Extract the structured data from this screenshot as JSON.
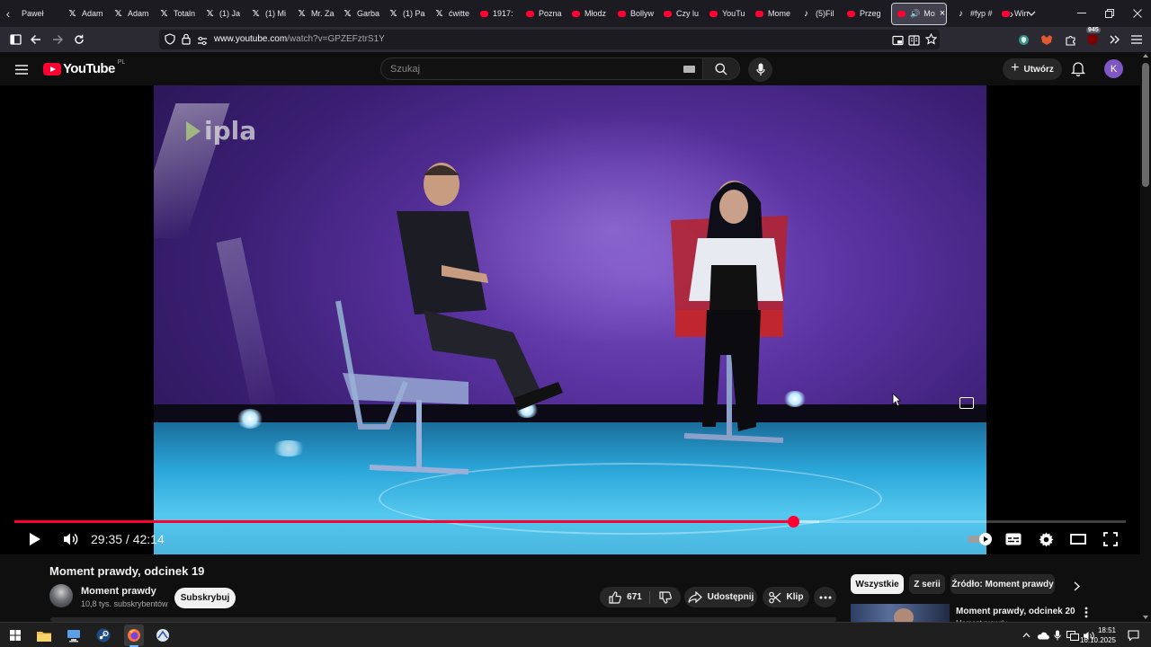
{
  "browser": {
    "tabs": [
      {
        "label": "Paweł",
        "icon": "none"
      },
      {
        "label": "Adam",
        "icon": "x"
      },
      {
        "label": "Adam",
        "icon": "x"
      },
      {
        "label": "Totaln",
        "icon": "x"
      },
      {
        "label": "(1) Ja",
        "icon": "x"
      },
      {
        "label": "(1) Mi",
        "icon": "x"
      },
      {
        "label": "Mr. Za",
        "icon": "x"
      },
      {
        "label": "Garba",
        "icon": "x"
      },
      {
        "label": "(1) Pa",
        "icon": "x"
      },
      {
        "label": "ćwitte",
        "icon": "x"
      },
      {
        "label": "1917:",
        "icon": "youtube"
      },
      {
        "label": "Pozna",
        "icon": "youtube"
      },
      {
        "label": "Młodz",
        "icon": "youtube"
      },
      {
        "label": "Bollyw",
        "icon": "youtube"
      },
      {
        "label": "Czy lu",
        "icon": "youtube"
      },
      {
        "label": "YouTu",
        "icon": "youtube"
      },
      {
        "label": "Mome",
        "icon": "youtube"
      },
      {
        "label": "(5)Fil",
        "icon": "tiktok"
      },
      {
        "label": "Przeg",
        "icon": "youtube"
      }
    ],
    "active_tab": {
      "label": "Mo",
      "icon": "youtube"
    },
    "tabs_after": [
      {
        "label": "#fyp #",
        "icon": "tiktok"
      },
      {
        "label": "Win",
        "icon": "youtube"
      }
    ],
    "url_host": "www.youtube.com",
    "url_path": "/watch?v=GPZEFztrS1Y",
    "extension_badge": "945"
  },
  "youtube": {
    "logo_text": "YouTube",
    "region": "PL",
    "search_placeholder": "Szukaj",
    "create_label": "Utwórz",
    "avatar_letter": "K"
  },
  "player": {
    "current_time": "29:35",
    "duration": "42:14",
    "time_display": "29:35 / 42:14",
    "progress_fraction": 0.7004,
    "buffered_fraction": 0.724,
    "watermark": "ipla"
  },
  "video": {
    "title": "Moment prawdy, odcinek 19",
    "channel_name": "Moment prawdy",
    "channel_subs": "10,8 tys. subskrybentów",
    "subscribe_label": "Subskrybuj",
    "like_count": "671",
    "share_label": "Udostępnij",
    "clip_label": "Klip"
  },
  "filters": {
    "chips": [
      "Wszystkie",
      "Z serii",
      "Źródło: Moment prawdy"
    ]
  },
  "recommendation": {
    "title": "Moment prawdy, odcinek 20",
    "channel": "Moment prawdy"
  },
  "taskbar": {
    "time": "18:51",
    "date": "16.10.2025"
  },
  "colors": {
    "yt_red": "#ff0033",
    "bg": "#0f0f0f",
    "pill": "#272727"
  }
}
